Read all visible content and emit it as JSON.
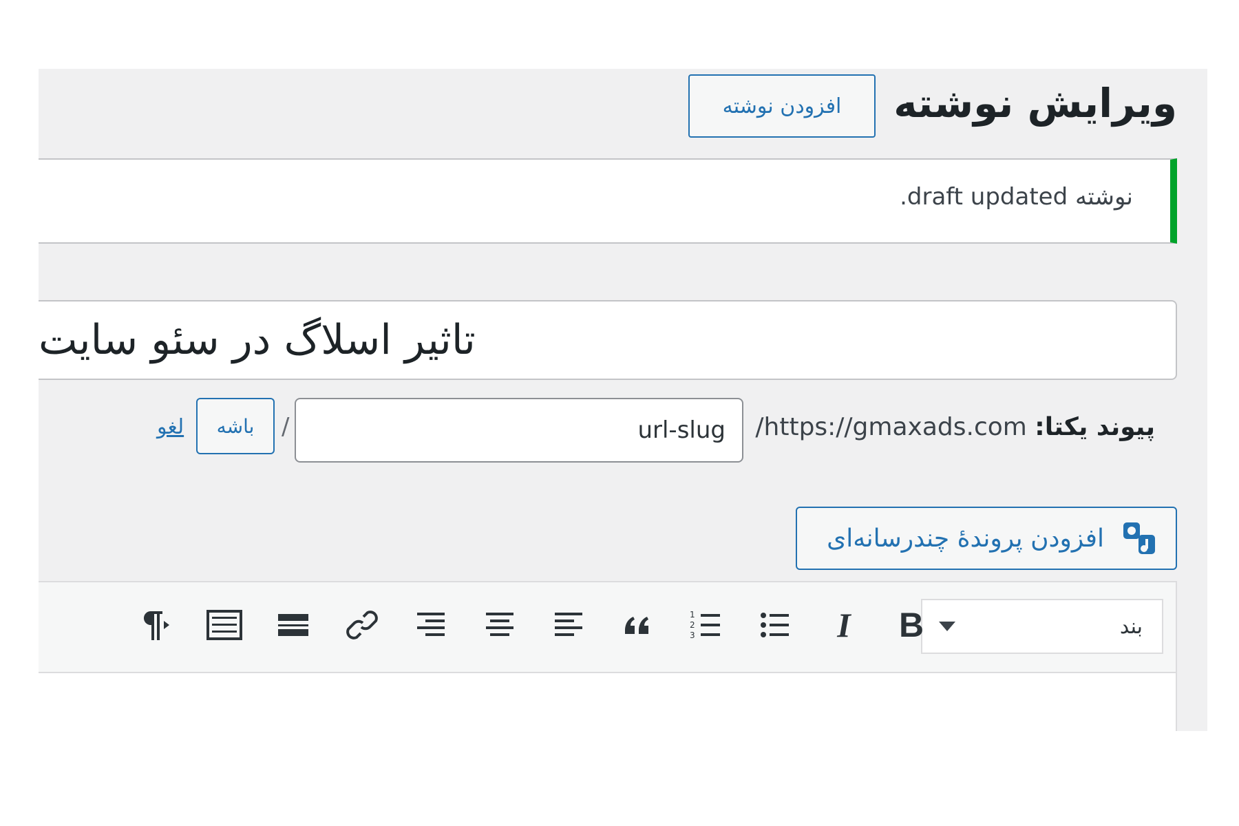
{
  "header": {
    "title": "ویرایش نوشته",
    "add_new_label": "افزودن نوشته"
  },
  "notice": {
    "text": "نوشته draft updated."
  },
  "post": {
    "title": "تاثیر اسلاگ در سئو سایت"
  },
  "permalink": {
    "label": "پیوند یکتا:",
    "base_url": "https://gmaxads.com/",
    "slug": "url-slug",
    "separator": "/",
    "ok_label": "باشه",
    "cancel_label": "لغو"
  },
  "media": {
    "add_label": "افزودن پروندهٔ چندرسانه‌ای",
    "icon": "media-icon"
  },
  "toolbar": {
    "format_value": "بند",
    "buttons": [
      "bold-icon",
      "italic-icon",
      "bulleted-list-icon",
      "numbered-list-icon",
      "blockquote-icon",
      "align-left-icon",
      "align-center-icon",
      "align-right-icon",
      "insert-link-icon",
      "read-more-icon",
      "toolbar-toggle-icon",
      "paragraph-direction-icon"
    ]
  },
  "colors": {
    "accent": "#2271b1",
    "success": "#00a32a",
    "background": "#f0f0f1",
    "text": "#1d2327"
  }
}
